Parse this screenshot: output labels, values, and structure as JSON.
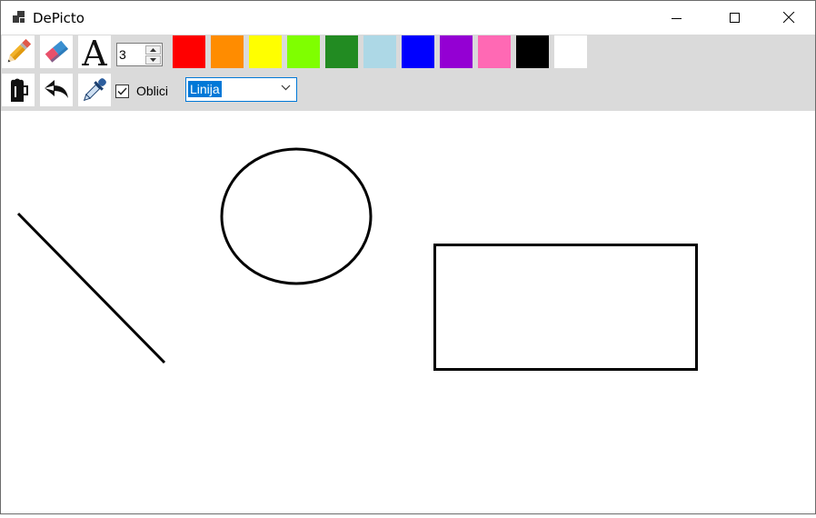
{
  "window": {
    "title": "DePicto",
    "controls": [
      "minimize",
      "maximize",
      "close"
    ]
  },
  "toolbar": {
    "tools_row1": [
      "pencil-icon",
      "eraser-icon",
      "text-icon"
    ],
    "tools_row2": [
      "bucket-fill-icon",
      "undo-icon",
      "eyedropper-icon"
    ],
    "brush_size": "3",
    "colors": [
      "#ff0000",
      "#ff8c00",
      "#ffff00",
      "#7fff00",
      "#228b22",
      "#add8e6",
      "#0000ff",
      "#9400d3",
      "#ff69b4",
      "#000000",
      "#ffffff"
    ],
    "shapes_checkbox": {
      "label": "Oblici",
      "checked": true
    },
    "shape_select": {
      "value": "Linija"
    }
  },
  "canvas": {
    "background": "#ffffff",
    "stroke_color": "#000000"
  }
}
